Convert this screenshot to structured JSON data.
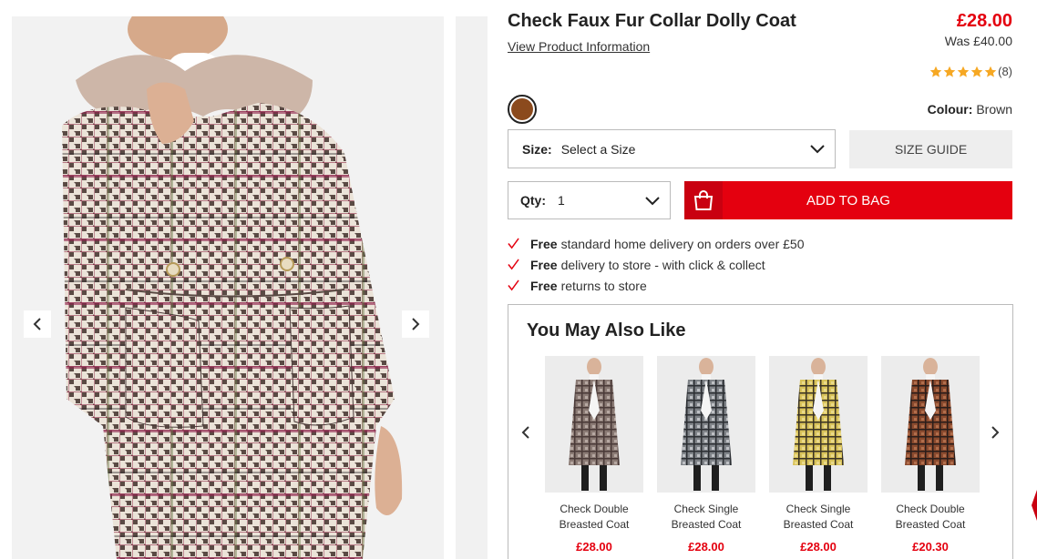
{
  "product": {
    "title": "Check Faux Fur Collar Dolly Coat",
    "view_info_label": "View Product Information",
    "price": "£28.00",
    "was_price": "Was £40.00",
    "rating_stars": 5,
    "review_count": "(8)",
    "colour_label": "Colour:",
    "colour_value": "Brown",
    "swatch_color": "#8b4a1d",
    "size_label": "Size:",
    "size_value": "Select a Size",
    "size_guide_label": "SIZE GUIDE",
    "qty_label": "Qty:",
    "qty_value": "1",
    "add_to_bag_label": "ADD TO BAG"
  },
  "benefits": [
    {
      "strong": "Free",
      "text": "standard home delivery on orders over £50"
    },
    {
      "strong": "Free",
      "text": "delivery to store - with click & collect"
    },
    {
      "strong": "Free",
      "text": "returns to store"
    }
  ],
  "recommendations": {
    "title": "You May Also Like",
    "items": [
      {
        "name": "Check Double Breasted Coat",
        "price": "£28.00",
        "palette": [
          "#8a7a74",
          "#4a3a38",
          "#c9bcb5"
        ]
      },
      {
        "name": "Check Single Breasted Coat",
        "price": "£28.00",
        "palette": [
          "#7f8388",
          "#2c2f33",
          "#d9dbde"
        ]
      },
      {
        "name": "Check Single Breasted Coat",
        "price": "£28.00",
        "palette": [
          "#d9c35a",
          "#3a3325",
          "#f0e3a0"
        ]
      },
      {
        "name": "Check Double Breasted Coat",
        "price": "£20.30",
        "palette": [
          "#8a4a2e",
          "#2a1d1a",
          "#c27d58"
        ]
      }
    ]
  },
  "colors": {
    "accent_red": "#e4000f",
    "star": "#f6a823",
    "coat_base": "#e9e1d6"
  },
  "icons": {
    "gallery_prev": "chevron-left-icon",
    "gallery_next": "chevron-right-icon",
    "bag": "shopping-bag-icon",
    "check": "check-icon",
    "star": "star-icon"
  }
}
